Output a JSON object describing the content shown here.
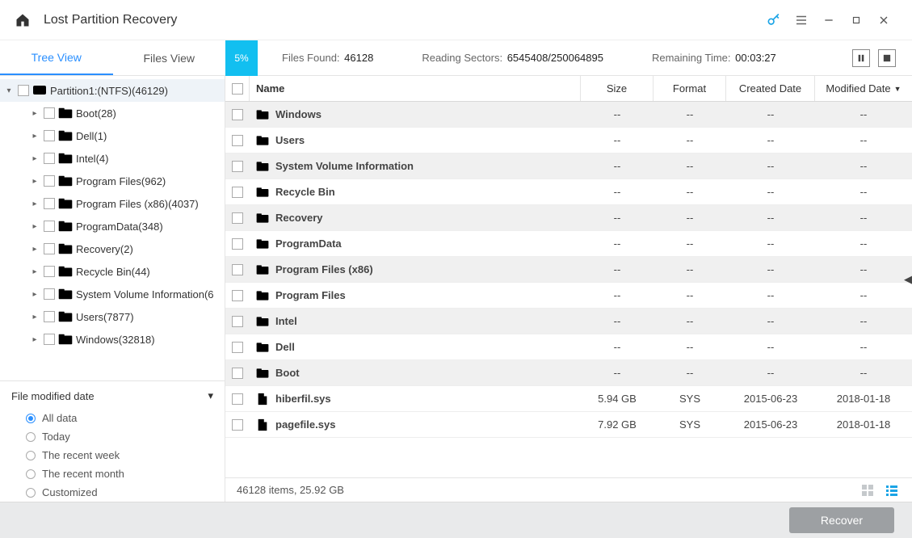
{
  "title": "Lost Partition Recovery",
  "tabs": {
    "tree": "Tree View",
    "files": "Files View"
  },
  "progress": {
    "percent": "5%",
    "filesFoundLabel": "Files Found:",
    "filesFound": "46128",
    "readingLabel": "Reading Sectors:",
    "reading": "6545408/250064895",
    "remainingLabel": "Remaining Time:",
    "remaining": "00:03:27"
  },
  "tree": {
    "root": "Partition1:(NTFS)(46129)",
    "children": [
      "Boot(28)",
      "Dell(1)",
      "Intel(4)",
      "Program Files(962)",
      "Program Files (x86)(4037)",
      "ProgramData(348)",
      "Recovery(2)",
      "Recycle Bin(44)",
      "System Volume Information(6",
      "Users(7877)",
      "Windows(32818)"
    ]
  },
  "filter": {
    "header": "File modified date",
    "options": [
      "All data",
      "Today",
      "The recent week",
      "The recent month",
      "Customized"
    ],
    "selected": 0
  },
  "columns": {
    "name": "Name",
    "size": "Size",
    "format": "Format",
    "created": "Created Date",
    "modified": "Modified Date"
  },
  "rows": [
    {
      "type": "folder",
      "name": "Windows",
      "size": "--",
      "format": "--",
      "created": "--",
      "modified": "--",
      "stripe": true
    },
    {
      "type": "folder",
      "name": "Users",
      "size": "--",
      "format": "--",
      "created": "--",
      "modified": "--",
      "stripe": false
    },
    {
      "type": "folder",
      "name": "System Volume Information",
      "size": "--",
      "format": "--",
      "created": "--",
      "modified": "--",
      "stripe": true
    },
    {
      "type": "folder",
      "name": "Recycle Bin",
      "size": "--",
      "format": "--",
      "created": "--",
      "modified": "--",
      "stripe": false
    },
    {
      "type": "folder",
      "name": "Recovery",
      "size": "--",
      "format": "--",
      "created": "--",
      "modified": "--",
      "stripe": true
    },
    {
      "type": "folder",
      "name": "ProgramData",
      "size": "--",
      "format": "--",
      "created": "--",
      "modified": "--",
      "stripe": false
    },
    {
      "type": "folder",
      "name": "Program Files (x86)",
      "size": "--",
      "format": "--",
      "created": "--",
      "modified": "--",
      "stripe": true
    },
    {
      "type": "folder",
      "name": "Program Files",
      "size": "--",
      "format": "--",
      "created": "--",
      "modified": "--",
      "stripe": false
    },
    {
      "type": "folder",
      "name": "Intel",
      "size": "--",
      "format": "--",
      "created": "--",
      "modified": "--",
      "stripe": true
    },
    {
      "type": "folder",
      "name": "Dell",
      "size": "--",
      "format": "--",
      "created": "--",
      "modified": "--",
      "stripe": false
    },
    {
      "type": "folder",
      "name": "Boot",
      "size": "--",
      "format": "--",
      "created": "--",
      "modified": "--",
      "stripe": true
    },
    {
      "type": "file",
      "name": "hiberfil.sys",
      "size": "5.94 GB",
      "format": "SYS",
      "created": "2015-06-23",
      "modified": "2018-01-18",
      "stripe": false
    },
    {
      "type": "file",
      "name": "pagefile.sys",
      "size": "7.92 GB",
      "format": "SYS",
      "created": "2015-06-23",
      "modified": "2018-01-18",
      "stripe": false
    }
  ],
  "status": "46128 items, 25.92 GB",
  "recover": "Recover"
}
